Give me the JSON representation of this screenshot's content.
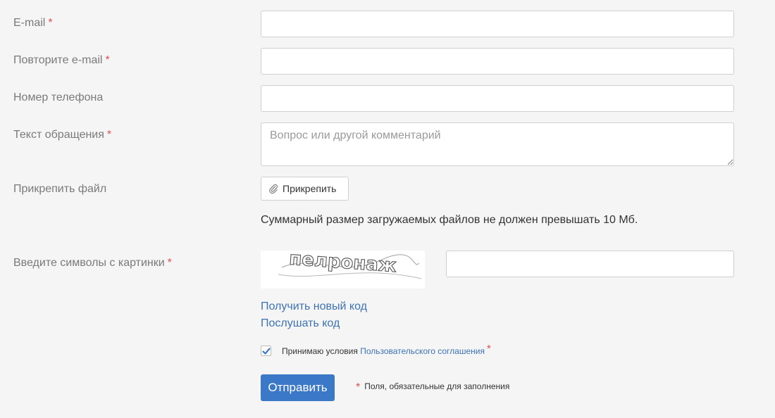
{
  "fields": {
    "email": {
      "label": "E-mail",
      "required_mark": "*",
      "value": ""
    },
    "email_repeat": {
      "label": "Повторите e-mail",
      "required_mark": "*",
      "value": ""
    },
    "phone": {
      "label": "Номер телефона",
      "value": ""
    },
    "message": {
      "label": "Текст обращения",
      "required_mark": "*",
      "placeholder": "Вопрос или другой комментарий",
      "value": ""
    },
    "file": {
      "label": "Прикрепить файл",
      "button_label": "Прикрепить"
    },
    "captcha": {
      "label": "Введите символы с картинки",
      "required_mark": "*",
      "image_text": "пелронаж",
      "value": ""
    }
  },
  "file_size_note": "Суммарный размер загружаемых файлов не должен превышать 10 Мб.",
  "captcha_links": {
    "new_code": "Получить новый код",
    "listen_code": "Послушать код"
  },
  "agreement": {
    "checked": true,
    "text": "Принимаю условия",
    "link_text": "Пользовательского соглашения",
    "required_mark": "*"
  },
  "submit_label": "Отправить",
  "required_note": {
    "mark": "*",
    "text": "Поля, обязательные для заполнения"
  },
  "colors": {
    "background": "#f5f5f5",
    "accent": "#3b79c8",
    "link": "#3d72b4",
    "required": "#d9534f"
  }
}
